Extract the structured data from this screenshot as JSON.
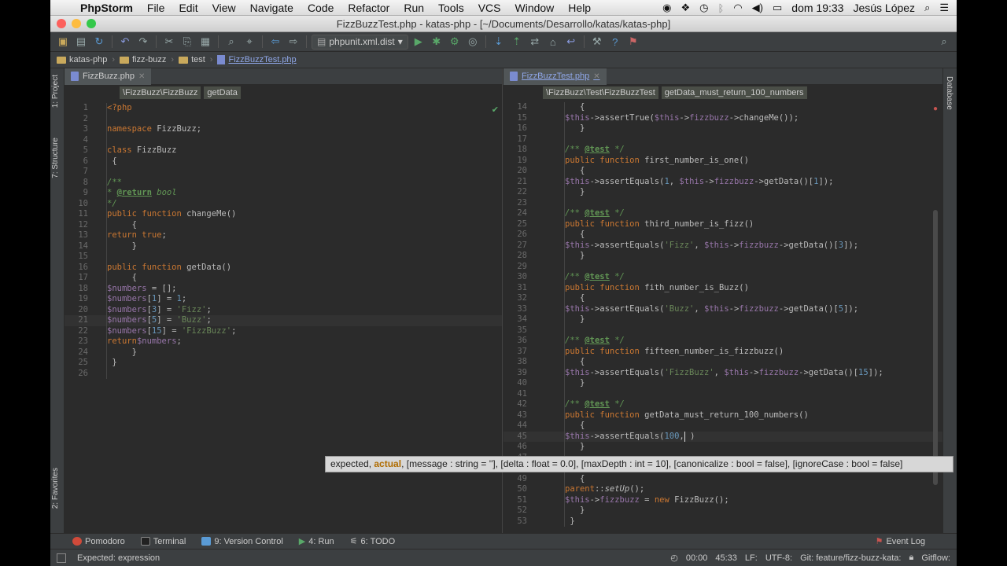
{
  "menubar": {
    "app": "PhpStorm",
    "menus": [
      "File",
      "Edit",
      "View",
      "Navigate",
      "Code",
      "Refactor",
      "Run",
      "Tools",
      "VCS",
      "Window",
      "Help"
    ],
    "clock": "dom 19:33",
    "user": "Jesús López"
  },
  "window": {
    "title": "FizzBuzzTest.php - katas-php - [~/Documents/Desarrollo/katas/katas-php]"
  },
  "toolbar": {
    "run_config": "phpunit.xml.dist"
  },
  "nav": {
    "crumbs": [
      "katas-php",
      "fizz-buzz",
      "test",
      "FizzBuzzTest.php"
    ]
  },
  "left_strip": {
    "project": "1: Project",
    "structure": "7: Structure",
    "favorites": "2: Favorites"
  },
  "right_strip": {
    "database": "Database"
  },
  "left_editor": {
    "tab": "FizzBuzz.php",
    "crumbs": [
      "\\FizzBuzz\\FizzBuzz",
      "getData"
    ]
  },
  "right_editor": {
    "tab": "FizzBuzzTest.php",
    "crumbs": [
      "\\FizzBuzz\\Test\\FizzBuzzTest",
      "getData_must_return_100_numbers"
    ]
  },
  "tooltip": {
    "pre": "expected, ",
    "bold": "actual",
    "post": ", [message : string = ''], [delta : float = 0.0], [maxDepth : int = 10], [canonicalize : bool = false], [ignoreCase : bool = false]"
  },
  "bottom_tools": [
    "Pomodoro",
    "Terminal",
    "9: Version Control",
    "4: Run",
    "6: TODO"
  ],
  "event_log": "Event Log",
  "status": {
    "message": "Expected: expression",
    "timer": "00:00",
    "position": "45:33",
    "lf": "LF:",
    "encoding": "UTF-8:",
    "git": "Git: feature/fizz-buzz-kata:",
    "gitflow": "Gitflow:"
  },
  "colors": {
    "bg": "#2b2b2b",
    "keyword": "#cc7832",
    "string": "#6a8759",
    "variable": "#9876aa",
    "number": "#6897bb",
    "function": "#ffc66d"
  }
}
